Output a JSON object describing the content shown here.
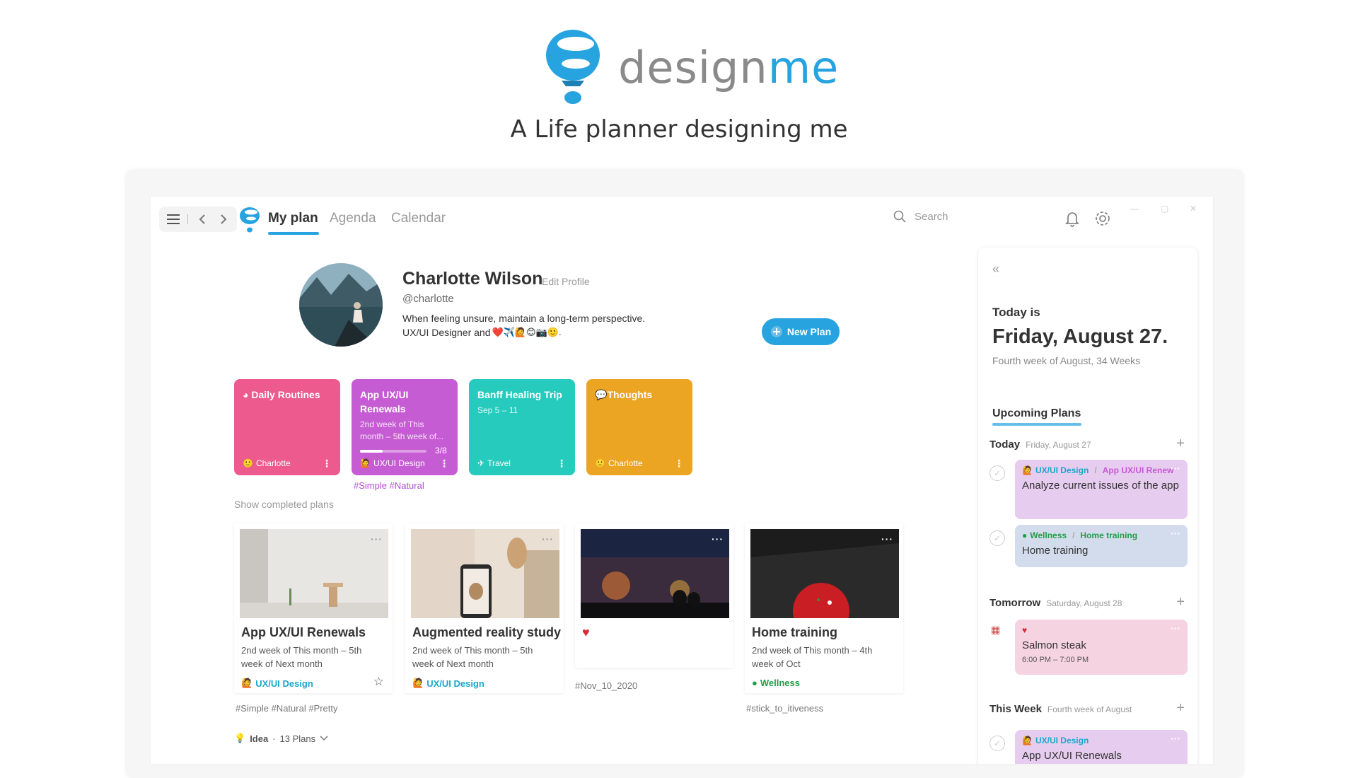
{
  "hero": {
    "brand_a": "design",
    "brand_b": "me",
    "tagline": "A Life planner designing me"
  },
  "colors": {
    "accent": "#27a3df",
    "pink": "#ec5a8e",
    "purple": "#c55cd3",
    "teal": "#26cbbe",
    "orange": "#eca423"
  },
  "nav": {
    "tabs": [
      "My plan",
      "Agenda",
      "Calendar"
    ],
    "search_placeholder": "Search"
  },
  "profile": {
    "name": "Charlotte Wilson",
    "edit": "Edit Profile",
    "handle": "@charlotte",
    "bio_line1": "When feeling unsure, maintain a long-term perspective.",
    "bio_line2": "UX/UI Designer and",
    "bio_emojis": "❤️✈️🙋😊📷🙂.",
    "new_plan": "New Plan"
  },
  "color_cards": [
    {
      "title": "Daily Routines",
      "sub": "",
      "footer": "Charlotte",
      "color": "#ec5a8e"
    },
    {
      "title": "App UX/UI Renewals",
      "sub": "2nd week of This month – 5th week of...",
      "progress": "3/8",
      "footer": "UX/UI Design",
      "color": "#c55cd3"
    },
    {
      "title": "Banff Healing Trip",
      "sub": "Sep 5 – 11",
      "footer": "Travel",
      "color": "#26cbbe"
    },
    {
      "title": "Thoughts",
      "sub": "",
      "footer": "Charlotte",
      "color": "#eca423"
    }
  ],
  "purple_tags": "#Simple  #Natural",
  "show_completed": "Show completed plans",
  "image_cards": [
    {
      "title": "App UX/UI Renewals",
      "sub": "2nd week of This month – 5th week of Next month",
      "cat": "UX/UI Design",
      "cat_color": "#1aa7c9",
      "tags": "#Simple  #Natural  #Pretty"
    },
    {
      "title": "Augmented reality study",
      "sub": "2nd week of This month – 5th week of Next month",
      "cat": "UX/UI Design",
      "cat_color": "#1aa7c9",
      "tags": ""
    },
    {
      "title": "",
      "sub": "",
      "cat": "",
      "cat_color": "",
      "tags": "#Nov_10_2020"
    },
    {
      "title": "Home training",
      "sub": "2nd week of This month – 4th week of Oct",
      "cat": "Wellness",
      "cat_color": "#1f9e48",
      "tags": "#stick_to_itiveness"
    }
  ],
  "idea": {
    "label": "Idea",
    "count": "13 Plans"
  },
  "panel": {
    "today_is": "Today is",
    "date": "Friday, August 27.",
    "week": "Fourth week of August, 34 Weeks",
    "upcoming": "Upcoming Plans",
    "sections": [
      {
        "name": "Today",
        "date": "Friday, August 27"
      },
      {
        "name": "Tomorrow",
        "date": "Saturday, August 28"
      },
      {
        "name": "This Week",
        "date": "Fourth week of August"
      }
    ],
    "tasks": [
      {
        "cat": "UX/UI Design",
        "sep": "/",
        "plan": "App UX/UI Renew",
        "title": "Analyze current issues of the app",
        "time": "",
        "bg": "#e6ccee"
      },
      {
        "cat": "Wellness",
        "sep": "/",
        "plan": "Home training",
        "title": "Home training",
        "time": "",
        "bg": "#d3dcec"
      },
      {
        "cat": "",
        "sep": "",
        "plan": "",
        "title": "Salmon steak",
        "time": "6:00 PM – 7:00 PM",
        "bg": "#f6d3e0"
      },
      {
        "cat": "UX/UI Design",
        "sep": "",
        "plan": "",
        "title": "App UX/UI Renewals",
        "time": "",
        "bg": "#e6ccee"
      }
    ]
  }
}
